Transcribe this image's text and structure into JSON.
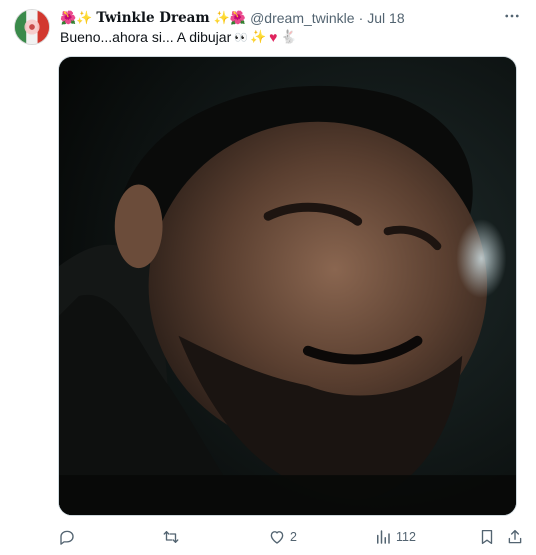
{
  "tweet": {
    "author": {
      "display_name": "Twinkle Dream",
      "name_prefix_emoji": "🌺✨",
      "name_suffix_emoji": "✨🌺",
      "handle": "@dream_twinkle",
      "separator": "·",
      "date": "Jul 18"
    },
    "text": "Bueno...ahora si... A dibujar",
    "text_emoji": {
      "eyes": "👀",
      "sparkle": "✨",
      "heart": "♥",
      "rabbit": "🐇"
    },
    "media": {
      "type": "image",
      "description_icon": "photo-icon"
    },
    "actions": {
      "reply_count": "",
      "retweet_count": "",
      "like_count": "2",
      "views_count": "112"
    }
  },
  "colors": {
    "text_primary": "#0f1419",
    "text_secondary": "#536471",
    "border": "#cfd9de",
    "heart": "#e0245e",
    "sparkle": "#f4b400"
  }
}
